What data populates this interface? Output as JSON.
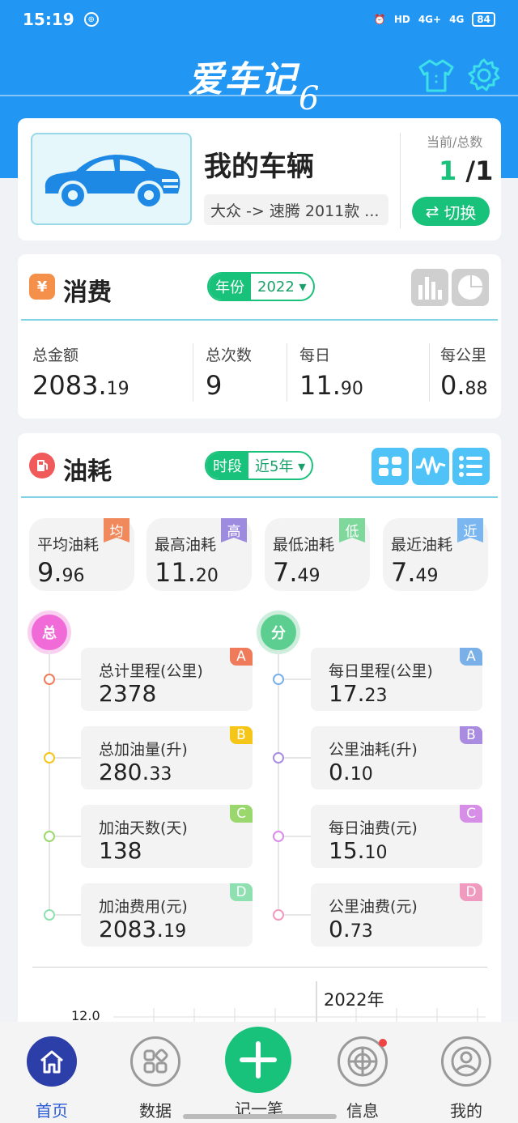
{
  "status": {
    "time": "15:19",
    "hd": "HD",
    "sig1": "4G+",
    "sig2": "4G",
    "battery": "84"
  },
  "app": {
    "title": "爱车记",
    "version": "6"
  },
  "vehicle": {
    "name": "我的车辆",
    "model": "大众 -> 速腾 2011款 ...",
    "count_label": "当前/总数",
    "current": "1",
    "total": "/1",
    "switch_label": "切换"
  },
  "consumption": {
    "title": "消费",
    "icon": "¥",
    "filter_key": "年份",
    "filter_value": "2022 ▾",
    "stats": [
      {
        "label": "总金额",
        "int": "2083.",
        "dec": "19"
      },
      {
        "label": "总次数",
        "int": "9",
        "dec": ""
      },
      {
        "label": "每日",
        "int": "11.",
        "dec": "90"
      },
      {
        "label": "每公里",
        "int": "0.",
        "dec": "88"
      }
    ]
  },
  "fuel": {
    "title": "油耗",
    "filter_key": "时段",
    "filter_value": "近5年 ▾",
    "summary": [
      {
        "label": "平均油耗",
        "int": "9.",
        "dec": "96",
        "flag": "均",
        "color": "#f08a5d"
      },
      {
        "label": "最高油耗",
        "int": "11.",
        "dec": "20",
        "flag": "高",
        "color": "#9d8be0"
      },
      {
        "label": "最低油耗",
        "int": "7.",
        "dec": "49",
        "flag": "低",
        "color": "#7ed89b"
      },
      {
        "label": "最近油耗",
        "int": "7.",
        "dec": "49",
        "flag": "近",
        "color": "#7ab6f0"
      }
    ],
    "total_head": "总",
    "part_head": "分",
    "total": [
      {
        "label": "总计里程(公里)",
        "int": "2378",
        "dec": "",
        "tag": "A",
        "color": "#f07b5a"
      },
      {
        "label": "总加油量(升)",
        "int": "280.",
        "dec": "33",
        "tag": "B",
        "color": "#f5c518"
      },
      {
        "label": "加油天数(天)",
        "int": "138",
        "dec": "",
        "tag": "C",
        "color": "#9ad86e"
      },
      {
        "label": "加油费用(元)",
        "int": "2083.",
        "dec": "19",
        "tag": "D",
        "color": "#8fe0b0"
      }
    ],
    "part": [
      {
        "label": "每日里程(公里)",
        "int": "17.",
        "dec": "23",
        "tag": "A",
        "color": "#7ab0e8"
      },
      {
        "label": "公里油耗(升)",
        "int": "0.",
        "dec": "10",
        "tag": "B",
        "color": "#a98be0"
      },
      {
        "label": "每日油费(元)",
        "int": "15.",
        "dec": "10",
        "tag": "C",
        "color": "#d78ee6"
      },
      {
        "label": "公里油费(元)",
        "int": "0.",
        "dec": "73",
        "tag": "D",
        "color": "#f09ac0"
      }
    ],
    "chart_year": "2022年",
    "chart_ytick": "12.0"
  },
  "nav": [
    {
      "label": "首页"
    },
    {
      "label": "数据"
    },
    {
      "label": "记一笔"
    },
    {
      "label": "信息"
    },
    {
      "label": "我的"
    }
  ]
}
